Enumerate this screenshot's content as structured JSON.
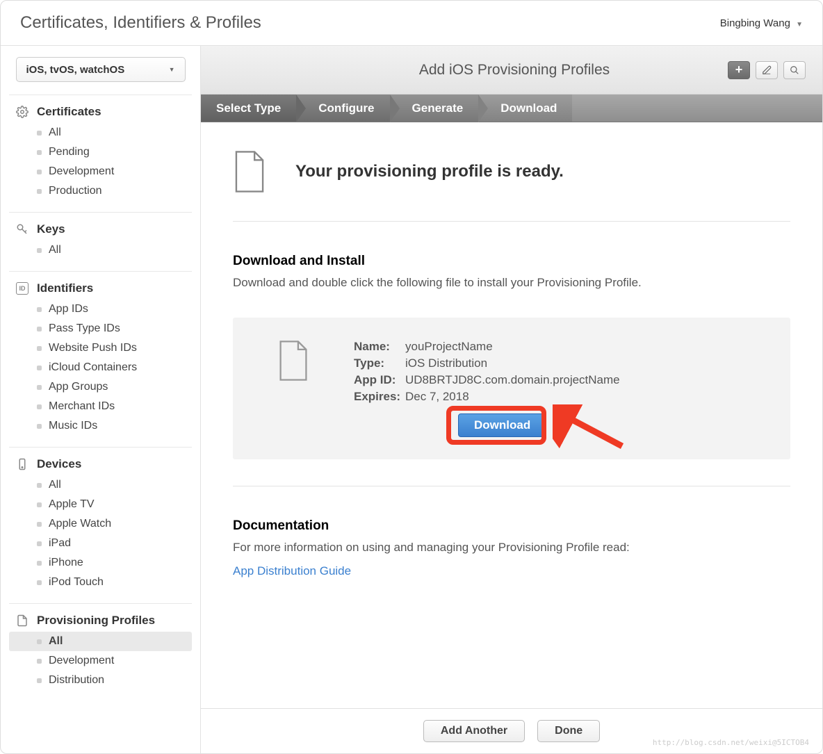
{
  "header": {
    "title": "Certificates, Identifiers & Profiles",
    "user_name": "Bingbing Wang"
  },
  "sidebar": {
    "platform_label": "iOS, tvOS, watchOS",
    "sections": [
      {
        "title": "Certificates",
        "icon": "gear",
        "items": [
          "All",
          "Pending",
          "Development",
          "Production"
        ]
      },
      {
        "title": "Keys",
        "icon": "key",
        "items": [
          "All"
        ]
      },
      {
        "title": "Identifiers",
        "icon": "id",
        "items": [
          "App IDs",
          "Pass Type IDs",
          "Website Push IDs",
          "iCloud Containers",
          "App Groups",
          "Merchant IDs",
          "Music IDs"
        ]
      },
      {
        "title": "Devices",
        "icon": "device",
        "items": [
          "All",
          "Apple TV",
          "Apple Watch",
          "iPad",
          "iPhone",
          "iPod Touch"
        ]
      },
      {
        "title": "Provisioning Profiles",
        "icon": "file",
        "items": [
          "All",
          "Development",
          "Distribution"
        ],
        "selected_index": 0
      }
    ]
  },
  "main": {
    "title": "Add iOS Provisioning Profiles",
    "wizard_steps": [
      "Select Type",
      "Configure",
      "Generate",
      "Download"
    ],
    "wizard_active_index": 3,
    "ready_text": "Your provisioning profile is ready.",
    "download_section": {
      "title": "Download and Install",
      "desc": "Download and double click the following file to install your Provisioning Profile."
    },
    "profile": {
      "name_label": "Name:",
      "name_value": "youProjectName",
      "type_label": "Type:",
      "type_value": "iOS Distribution",
      "appid_label": "App ID:",
      "appid_value": "UD8BRTJD8C.com.domain.projectName",
      "expires_label": "Expires:",
      "expires_value": "Dec 7, 2018",
      "download_button": "Download"
    },
    "documentation": {
      "title": "Documentation",
      "desc": "For more information on using and managing your Provisioning Profile read:",
      "link_text": "App Distribution Guide"
    },
    "footer": {
      "add_another": "Add Another",
      "done": "Done"
    }
  },
  "watermark": "http://blog.csdn.net/weixi@5ICTOB4"
}
